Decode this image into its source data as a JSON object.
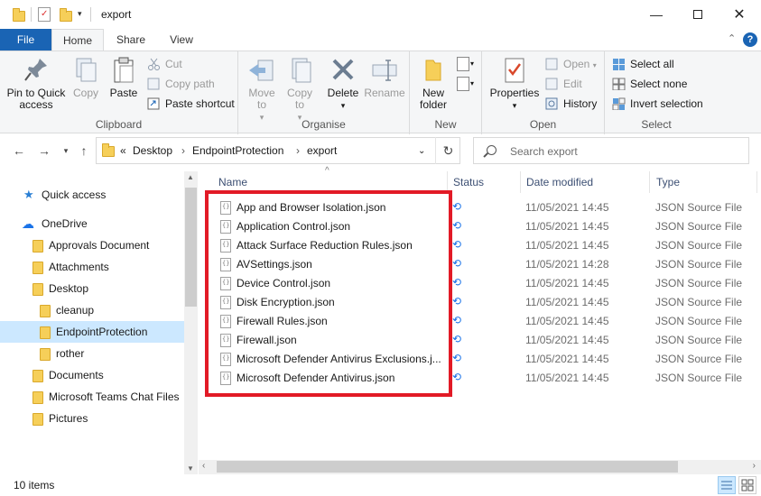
{
  "window": {
    "title": "export"
  },
  "ribbon_tabs": [
    "File",
    "Home",
    "Share",
    "View"
  ],
  "clipboard": {
    "pin": "Pin to Quick access",
    "copy": "Copy",
    "paste": "Paste",
    "cut": "Cut",
    "copy_path": "Copy path",
    "paste_shortcut": "Paste shortcut",
    "label": "Clipboard"
  },
  "organise": {
    "move_to": "Move to",
    "copy_to": "Copy to",
    "delete": "Delete",
    "rename": "Rename",
    "label": "Organise"
  },
  "new_group": {
    "new_folder": "New folder",
    "label": "New"
  },
  "open_group": {
    "properties": "Properties",
    "open": "Open",
    "edit": "Edit",
    "history": "History",
    "label": "Open"
  },
  "select_group": {
    "select_all": "Select all",
    "select_none": "Select none",
    "invert": "Invert selection",
    "label": "Select"
  },
  "address": {
    "overflow": "«",
    "crumbs": [
      "Desktop",
      "EndpointProtection",
      "export"
    ]
  },
  "search": {
    "placeholder": "Search export"
  },
  "nav": {
    "quick_access": "Quick access",
    "onedrive": "OneDrive",
    "items": [
      "Approvals Document",
      "Attachments",
      "Desktop",
      "cleanup",
      "EndpointProtection",
      "rother",
      "Documents",
      "Microsoft Teams Chat Files",
      "Pictures"
    ]
  },
  "columns": {
    "name": "Name",
    "status": "Status",
    "date": "Date modified",
    "type": "Type"
  },
  "files": [
    {
      "name": "App and Browser Isolation.json",
      "date": "11/05/2021 14:45",
      "type": "JSON Source File"
    },
    {
      "name": "Application Control.json",
      "date": "11/05/2021 14:45",
      "type": "JSON Source File"
    },
    {
      "name": "Attack Surface Reduction Rules.json",
      "date": "11/05/2021 14:45",
      "type": "JSON Source File"
    },
    {
      "name": "AVSettings.json",
      "date": "11/05/2021 14:28",
      "type": "JSON Source File"
    },
    {
      "name": "Device Control.json",
      "date": "11/05/2021 14:45",
      "type": "JSON Source File"
    },
    {
      "name": "Disk Encryption.json",
      "date": "11/05/2021 14:45",
      "type": "JSON Source File"
    },
    {
      "name": "Firewall Rules.json",
      "date": "11/05/2021 14:45",
      "type": "JSON Source File"
    },
    {
      "name": "Firewall.json",
      "date": "11/05/2021 14:45",
      "type": "JSON Source File"
    },
    {
      "name": "Microsoft Defender Antivirus Exclusions.j...",
      "date": "11/05/2021 14:45",
      "type": "JSON Source File"
    },
    {
      "name": "Microsoft Defender Antivirus.json",
      "date": "11/05/2021 14:45",
      "type": "JSON Source File"
    }
  ],
  "status": {
    "count": "10 items"
  },
  "colors": {
    "accent": "#1a64b4",
    "highlight": "#e21a26",
    "selected": "#cce8ff",
    "sync": "#1a73e8"
  }
}
